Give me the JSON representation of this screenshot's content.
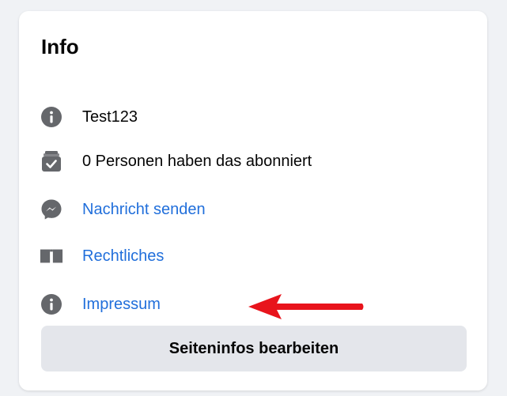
{
  "card": {
    "title": "Info",
    "items": [
      {
        "icon": "info-icon",
        "label": "Test123",
        "link": false
      },
      {
        "icon": "subscribe-check-icon",
        "label": "0 Personen haben das abonniert",
        "link": false
      },
      {
        "icon": "messenger-icon",
        "label": "Nachricht senden",
        "link": true
      },
      {
        "icon": "book-icon",
        "label": "Rechtliches",
        "link": true
      },
      {
        "icon": "info-icon",
        "label": "Impressum",
        "link": true
      }
    ],
    "edit_button_label": "Seiteninfos bearbeiten"
  },
  "annotation": {
    "icon": "red-arrow-icon",
    "color": "#e8141c"
  },
  "colors": {
    "link": "#216fdb",
    "icon": "#65676b",
    "button_bg": "#e4e6eb",
    "page_bg": "#f0f2f5"
  }
}
